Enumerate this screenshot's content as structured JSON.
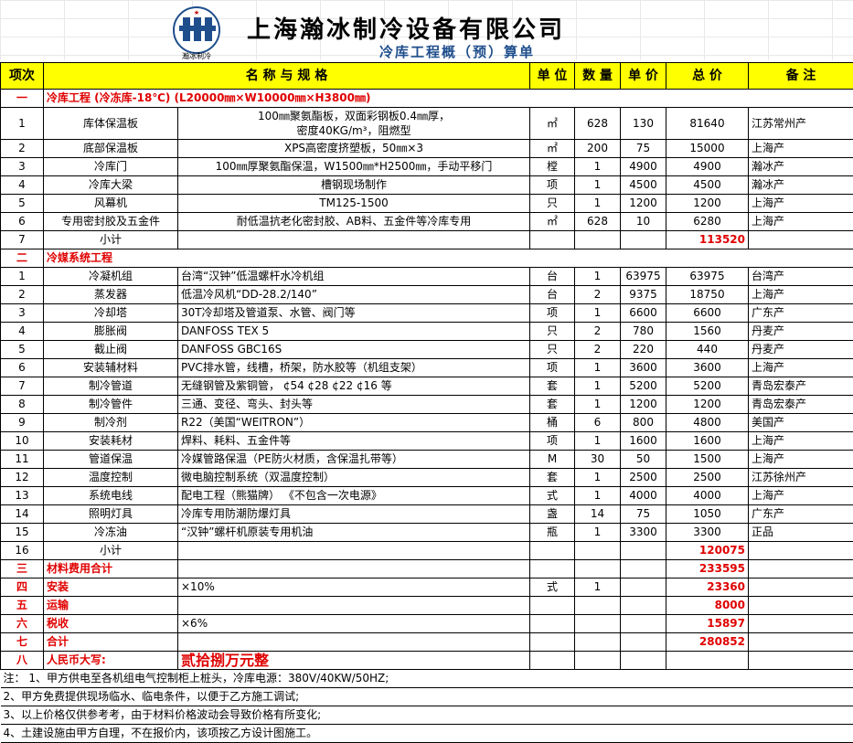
{
  "header": {
    "logo_text": "瀚冰制冷",
    "company": "上海瀚冰制冷设备有限公司",
    "subtitle": "冷库工程概（预）算单"
  },
  "columns": [
    "项次",
    "名 称 与 规 格",
    "单 位",
    "数 量",
    "单 价",
    "总 价",
    "备 注"
  ],
  "section1": {
    "num": "一",
    "title": "冷库工程    (冷冻库-18℃)  (L20000㎜×W10000㎜×H3800㎜)",
    "rows": [
      {
        "idx": "1",
        "name": "库体保温板",
        "spec": "100㎜聚氨酯板，双面彩钢板0.4㎜厚，",
        "spec2": "密度40KG/m³，阻燃型",
        "unit": "㎡",
        "qty": "628",
        "price": "130",
        "total": "81640",
        "note": "江苏常州产"
      },
      {
        "idx": "2",
        "name": "底部保温板",
        "spec": "XPS高密度挤塑板，50㎜×3",
        "unit": "㎡",
        "qty": "200",
        "price": "75",
        "total": "15000",
        "note": "上海产"
      },
      {
        "idx": "3",
        "name": "冷库门",
        "spec": "100㎜厚聚氨酯保温，W1500㎜*H2500㎜，手动平移门",
        "unit": "樘",
        "qty": "1",
        "price": "4900",
        "total": "4900",
        "note": "瀚冰产"
      },
      {
        "idx": "4",
        "name": "冷库大梁",
        "spec": "槽钢现场制作",
        "unit": "项",
        "qty": "1",
        "price": "4500",
        "total": "4500",
        "note": "瀚冰产"
      },
      {
        "idx": "5",
        "name": "风幕机",
        "spec": "TM125-1500",
        "unit": "只",
        "qty": "1",
        "price": "1200",
        "total": "1200",
        "note": "上海产"
      },
      {
        "idx": "6",
        "name": "专用密封胶及五金件",
        "spec": "耐低温抗老化密封胶、AB料、五金件等冷库专用",
        "unit": "㎡",
        "qty": "628",
        "price": "10",
        "total": "6280",
        "note": "上海产"
      }
    ],
    "subtotal_idx": "7",
    "subtotal_label": "小计",
    "subtotal": "113520"
  },
  "section2": {
    "num": "二",
    "title": "冷媒系统工程",
    "rows": [
      {
        "idx": "1",
        "name": "冷凝机组",
        "spec": "台湾“汉钟”低温螺杆水冷机组",
        "unit": "台",
        "qty": "1",
        "price": "63975",
        "total": "63975",
        "note": "台湾产"
      },
      {
        "idx": "2",
        "name": "蒸发器",
        "spec": "低温冷风机“DD-28.2/140”",
        "unit": "台",
        "qty": "2",
        "price": "9375",
        "total": "18750",
        "note": "上海产"
      },
      {
        "idx": "3",
        "name": "冷却塔",
        "spec": "30T冷却塔及管道泵、水管、阀门等",
        "unit": "项",
        "qty": "1",
        "price": "6600",
        "total": "6600",
        "note": "广东产"
      },
      {
        "idx": "4",
        "name": "膨胀阀",
        "spec": "DANFOSS TEX 5",
        "unit": "只",
        "qty": "2",
        "price": "780",
        "total": "1560",
        "note": "丹麦产"
      },
      {
        "idx": "5",
        "name": "截止阀",
        "spec": "DANFOSS GBC16S",
        "unit": "只",
        "qty": "2",
        "price": "220",
        "total": "440",
        "note": "丹麦产"
      },
      {
        "idx": "6",
        "name": "安装辅材料",
        "spec": "PVC排水管，线槽，桥架，防水胶等（机组支架）",
        "unit": "项",
        "qty": "1",
        "price": "3600",
        "total": "3600",
        "note": "上海产"
      },
      {
        "idx": "7",
        "name": "制冷管道",
        "spec": "无缝钢管及紫铜管，  ¢54 ¢28 ¢22 ¢16 等",
        "unit": "套",
        "qty": "1",
        "price": "5200",
        "total": "5200",
        "note": "青岛宏泰产"
      },
      {
        "idx": "8",
        "name": "制冷管件",
        "spec": "三通、变径、弯头、封头等",
        "unit": "套",
        "qty": "1",
        "price": "1200",
        "total": "1200",
        "note": "青岛宏泰产"
      },
      {
        "idx": "9",
        "name": "制冷剂",
        "spec": "R22（美国“WEITRON”）",
        "unit": "桶",
        "qty": "6",
        "price": "800",
        "total": "4800",
        "note": "美国产"
      },
      {
        "idx": "10",
        "name": "安装耗材",
        "spec": "焊料、耗料、五金件等",
        "unit": "项",
        "qty": "1",
        "price": "1600",
        "total": "1600",
        "note": "上海产"
      },
      {
        "idx": "11",
        "name": "管道保温",
        "spec": "冷媒管路保温（PE防火材质，含保温扎带等）",
        "unit": "M",
        "qty": "30",
        "price": "50",
        "total": "1500",
        "note": "上海产"
      },
      {
        "idx": "12",
        "name": "温度控制",
        "spec": "微电脑控制系统（双温度控制）",
        "unit": "套",
        "qty": "1",
        "price": "2500",
        "total": "2500",
        "note": "江苏徐州产"
      },
      {
        "idx": "13",
        "name": "系统电线",
        "spec": "配电工程（熊猫牌）  《不包含一次电源》",
        "unit": "式",
        "qty": "1",
        "price": "4000",
        "total": "4000",
        "note": "上海产"
      },
      {
        "idx": "14",
        "name": "照明灯具",
        "spec": "冷库专用防潮防爆灯具",
        "unit": "盏",
        "qty": "14",
        "price": "75",
        "total": "1050",
        "note": "广东产"
      },
      {
        "idx": "15",
        "name": "冷冻油",
        "spec": "“汉钟”螺杆机原装专用机油",
        "unit": "瓶",
        "qty": "1",
        "price": "3300",
        "total": "3300",
        "note": "正品"
      }
    ],
    "subtotal_idx": "16",
    "subtotal_label": "小计",
    "subtotal": "120075"
  },
  "summary": [
    {
      "num": "三",
      "label": "材料费用合计",
      "extra": "",
      "unit": "",
      "qty": "",
      "total": "233595"
    },
    {
      "num": "四",
      "label": "安装",
      "extra": "×10%",
      "unit": "式",
      "qty": "1",
      "total": "23360"
    },
    {
      "num": "五",
      "label": "运输",
      "extra": "",
      "unit": "",
      "qty": "",
      "total": "8000"
    },
    {
      "num": "六",
      "label": "税收",
      "extra": "×6%",
      "unit": "",
      "qty": "",
      "total": "15897"
    },
    {
      "num": "七",
      "label": "合计",
      "extra": "",
      "unit": "",
      "qty": "",
      "total": "280852"
    }
  ],
  "capital": {
    "num": "八",
    "label": "人民币大写:",
    "value": "贰拾捌万元整"
  },
  "notes": [
    "注：  1、甲方供电至各机组电气控制柜上桩头，冷库电源：380V/40KW/50HZ;",
    "       2、甲方免费提供现场临水、临电条件，以便于乙方施工调试;",
    "       3、以上价格仅供参考考，由于材料价格波动会导致价格有所变化;",
    "       4、土建设施由甲方自理，不在报价内，该项按乙方设计图施工。"
  ]
}
